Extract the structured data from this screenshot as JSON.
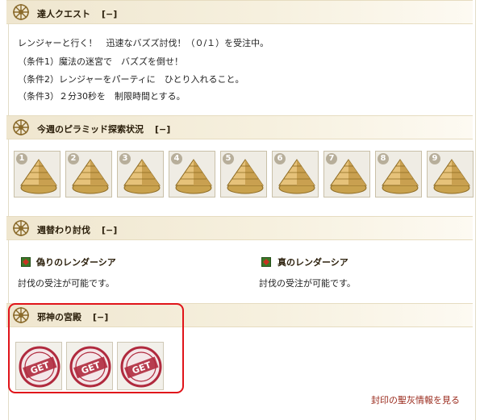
{
  "sections": {
    "master_quest": {
      "title": "達人クエスト",
      "toggle": "[−]",
      "lines": [
        "レンジャーと行く！　迅速なバズズ討伐！（０/１）を受注中。",
        "（条件1）魔法の迷宮で　バズズを倒せ！",
        "（条件2）レンジャーをパーティに　ひとり入れること。",
        "（条件3）２分30秒を　制限時間とする。"
      ]
    },
    "pyramid": {
      "title": "今週のピラミッド探索状況",
      "toggle": "[−]",
      "items": [
        "1",
        "2",
        "3",
        "4",
        "5",
        "6",
        "7",
        "8",
        "9"
      ]
    },
    "weekly_hunt": {
      "title": "週替わり討伐",
      "toggle": "[−]",
      "targets": [
        {
          "name": "偽りのレンダーシア",
          "status": "討伐の受注が可能です。"
        },
        {
          "name": "真のレンダーシア",
          "status": "討伐の受注が可能です。"
        }
      ]
    },
    "evil_god_palace": {
      "title": "邪神の宮殿",
      "toggle": "[−]",
      "badge_text": "GET",
      "badge_count": 3
    }
  },
  "footer": {
    "link": "封印の聖灰情報を見る"
  },
  "colors": {
    "highlight_border": "#e0141a",
    "link": "#9a2a1c",
    "gem_red": "#c8321f",
    "gem_green": "#3a7a28",
    "stamp": "#b02a3e"
  },
  "icons": {
    "section_emblem": "wheel-emblem-icon",
    "pyramid": "pyramid-icon",
    "target_gem": "gem-icon",
    "get_stamp": "get-stamp-icon"
  }
}
